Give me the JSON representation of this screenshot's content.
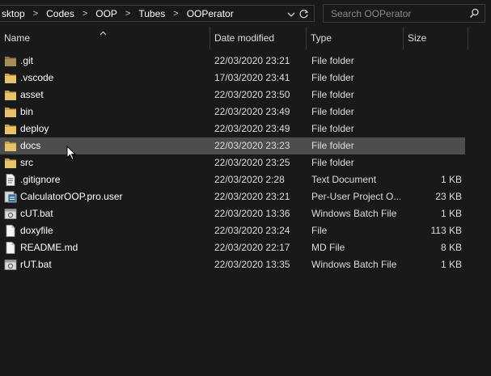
{
  "address": {
    "crumbs": [
      "sktop",
      "Codes",
      "OOP",
      "Tubes",
      "OOPerator"
    ],
    "separator": ">"
  },
  "search": {
    "placeholder": "Search OOPerator"
  },
  "columns": {
    "name": "Name",
    "date": "Date modified",
    "type": "Type",
    "size": "Size"
  },
  "files": [
    {
      "name": ".git",
      "date": "22/03/2020 23:21",
      "type": "File folder",
      "size": "",
      "icon": "folder-git-icon"
    },
    {
      "name": ".vscode",
      "date": "17/03/2020 23:41",
      "type": "File folder",
      "size": "",
      "icon": "folder-icon"
    },
    {
      "name": "asset",
      "date": "22/03/2020 23:50",
      "type": "File folder",
      "size": "",
      "icon": "folder-icon"
    },
    {
      "name": "bin",
      "date": "22/03/2020 23:49",
      "type": "File folder",
      "size": "",
      "icon": "folder-icon"
    },
    {
      "name": "deploy",
      "date": "22/03/2020 23:49",
      "type": "File folder",
      "size": "",
      "icon": "folder-icon"
    },
    {
      "name": "docs",
      "date": "22/03/2020 23:23",
      "type": "File folder",
      "size": "",
      "icon": "folder-icon"
    },
    {
      "name": "src",
      "date": "22/03/2020 23:25",
      "type": "File folder",
      "size": "",
      "icon": "folder-icon"
    },
    {
      "name": ".gitignore",
      "date": "22/03/2020 2:28",
      "type": "Text Document",
      "size": "1 KB",
      "icon": "text-file-icon"
    },
    {
      "name": "CalculatorOOP.pro.user",
      "date": "22/03/2020 23:21",
      "type": "Per-User Project O...",
      "size": "23 KB",
      "icon": "user-file-icon"
    },
    {
      "name": "cUT.bat",
      "date": "22/03/2020 13:36",
      "type": "Windows Batch File",
      "size": "1 KB",
      "icon": "batch-file-icon"
    },
    {
      "name": "doxyfile",
      "date": "22/03/2020 23:24",
      "type": "File",
      "size": "113 KB",
      "icon": "blank-file-icon"
    },
    {
      "name": "README.md",
      "date": "22/03/2020 22:17",
      "type": "MD File",
      "size": "8 KB",
      "icon": "blank-file-icon"
    },
    {
      "name": "rUT.bat",
      "date": "22/03/2020 13:35",
      "type": "Windows Batch File",
      "size": "1 KB",
      "icon": "batch-file-icon"
    }
  ],
  "hovered_row": "docs",
  "colors": {
    "background": "#191919",
    "hover": "#4d4d4d",
    "folder": "#dcb65a",
    "border": "#3c3c3c"
  }
}
